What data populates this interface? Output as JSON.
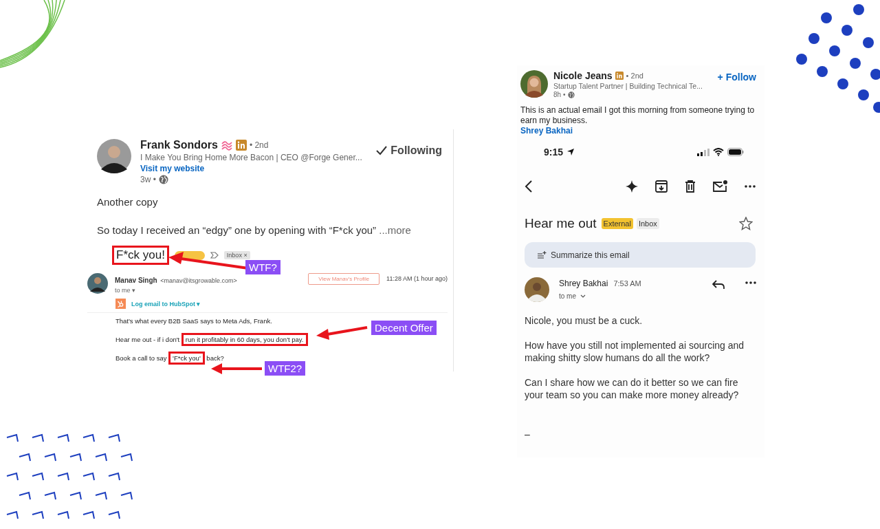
{
  "left_post": {
    "author": "Frank Sondors",
    "degree": "• 2nd",
    "following": "Following",
    "headline": "I Make You Bring Home More Bacon | CEO @Forge Gener...",
    "link": "Visit my website",
    "time": "3w •",
    "intro": "Another copy",
    "text": "So today I received an “edgy” one by opening with “F*ck you”",
    "more": "...more",
    "email": {
      "subject": "F*ck you!",
      "subject_highlighted": true,
      "inbox_tag": "Inbox",
      "inbox_close": "×",
      "sender": "Manav Singh",
      "sender_email": "<manav@itsgrowable.com>",
      "to": "to me",
      "to_caret": "▾",
      "profile_button": "View Manav's Profile",
      "time": "11:28 AM (1 hour ago)",
      "hubspot": "Log email to HubSpot",
      "hubspot_caret": "▾",
      "body": [
        [
          {
            "text": "That's what every B2B SaaS says to Meta Ads, Frank.",
            "highlighted": false
          }
        ],
        [
          {
            "text": "Hear me out - if i don't ",
            "highlighted": false
          },
          {
            "text": "run it profitably in 60 days, you don't pay.",
            "highlighted": true
          }
        ],
        [
          {
            "text": "Book a call to say ",
            "highlighted": false
          },
          {
            "text": "'F*ck you'",
            "highlighted": true
          },
          {
            "text": " back?",
            "highlighted": false
          }
        ]
      ]
    },
    "annotations": [
      {
        "label": "WTF?"
      },
      {
        "label": "Decent Offer"
      },
      {
        "label": "WTF2?"
      }
    ]
  },
  "right_post": {
    "author": "Nicole Jeans",
    "degree": "• 2nd",
    "follow": "+ Follow",
    "headline": "Startup Talent Partner | Building Technical Te...",
    "time": "8h •",
    "text": "This is an actual email I got this morning from someone trying to earn my business.",
    "mention": "Shrey Bakhai",
    "phone": {
      "clock": "9:15",
      "subject": "Hear me out",
      "tags": [
        {
          "text": "External",
          "color": "#f2c230"
        },
        {
          "text": "Inbox",
          "color": "#ececec"
        }
      ],
      "summarize": "Summarize this email",
      "sender": "Shrey Bakhai",
      "time": "7:53 AM",
      "to": "to me",
      "paragraphs": [
        "Nicole, you must be a cuck.",
        "How have you still not implemented ai sourcing and making shitty slow humans do all the work?",
        "Can I share how we can do it better so we can fire your team so you can make more money already?"
      ],
      "signature": "–"
    }
  }
}
